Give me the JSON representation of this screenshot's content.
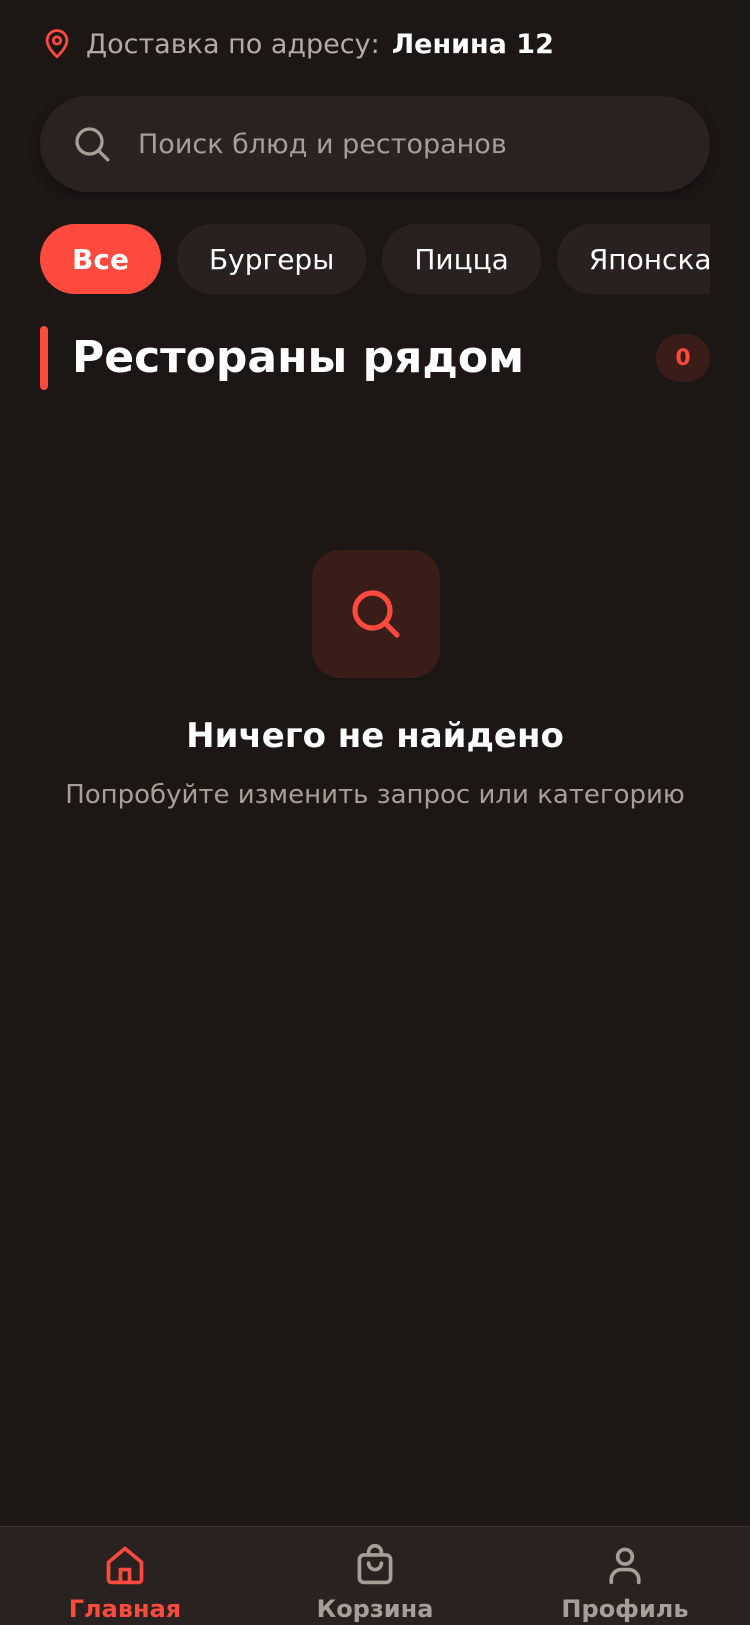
{
  "delivery": {
    "label": "Доставка по адресу:",
    "address": "Ленина 12",
    "icon": "location-pin-icon"
  },
  "search": {
    "placeholder": "Поиск блюд и ресторанов",
    "value": "",
    "icon": "search-icon"
  },
  "categories": [
    {
      "label": "Все",
      "active": true
    },
    {
      "label": "Бургеры",
      "active": false
    },
    {
      "label": "Пицца",
      "active": false
    },
    {
      "label": "Японская",
      "active": false
    }
  ],
  "section": {
    "title": "Рестораны рядом",
    "count": "0"
  },
  "empty_state": {
    "icon": "search-icon",
    "title": "Ничего не найдено",
    "subtitle": "Попробуйте изменить запрос или категорию"
  },
  "bottom_nav": {
    "items": [
      {
        "label": "Главная",
        "icon": "home-icon",
        "active": true
      },
      {
        "label": "Корзина",
        "icon": "shopping-bag-icon",
        "active": false
      },
      {
        "label": "Профиль",
        "icon": "user-icon",
        "active": false
      }
    ]
  },
  "colors": {
    "background": "#1c1715",
    "surface": "#2a2220",
    "accent": "#ff4a3d",
    "muted_text": "#a89d97"
  }
}
